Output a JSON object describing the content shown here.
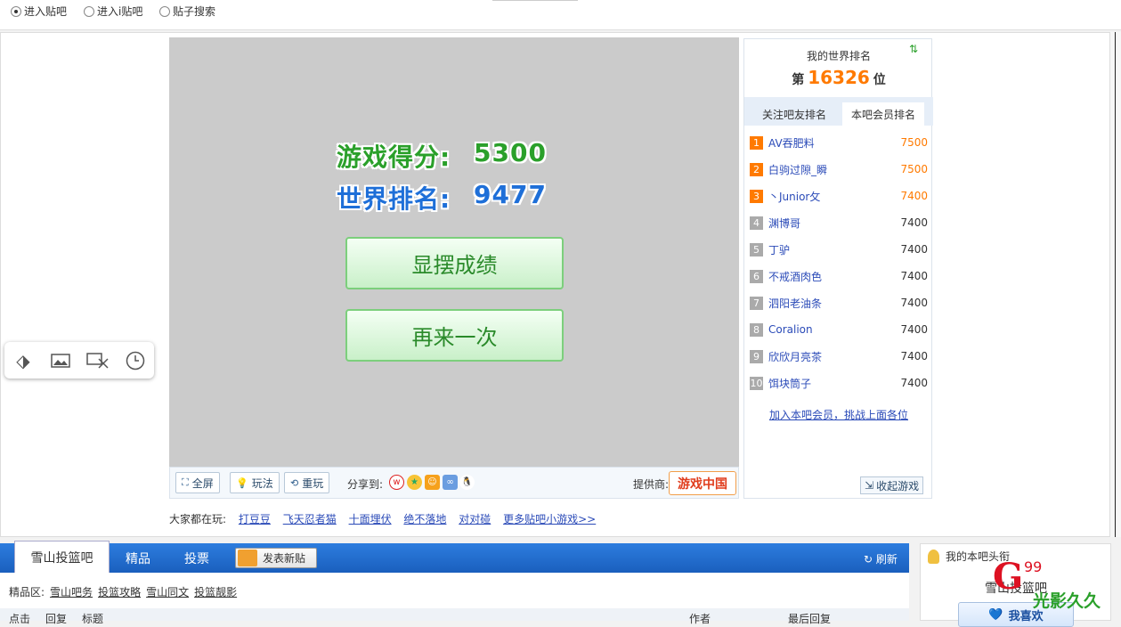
{
  "topbar": {
    "radio1": "进入贴吧",
    "radio2": "进入i贴吧",
    "radio3": "贴子搜索"
  },
  "game": {
    "score_label": "游戏得分:",
    "score_value": "5300",
    "rank_label": "世界排名:",
    "rank_value": "9477",
    "show_btn": "显摆成绩",
    "again_btn": "再来一次"
  },
  "toolbar": {
    "fullscreen": "全屏",
    "howto": "玩法",
    "replay": "重玩",
    "share_to": "分享到:",
    "provider": "提供商:",
    "provider_logo": "游戏中国"
  },
  "ranking": {
    "title": "我的世界排名",
    "prefix": "第",
    "position": "16326",
    "suffix": "位",
    "tab1": "关注吧友排名",
    "tab2": "本吧会员排名",
    "rows": [
      {
        "no": "1",
        "name": "AV吞肥料",
        "score": "7500"
      },
      {
        "no": "2",
        "name": "白驹过隙_瞬",
        "score": "7500"
      },
      {
        "no": "3",
        "name": "丶Junior攵",
        "score": "7400"
      },
      {
        "no": "4",
        "name": "渊博哥",
        "score": "7400"
      },
      {
        "no": "5",
        "name": "丁驴",
        "score": "7400"
      },
      {
        "no": "6",
        "name": "不戒酒肉色",
        "score": "7400"
      },
      {
        "no": "7",
        "name": "泗阳老油条",
        "score": "7400"
      },
      {
        "no": "8",
        "name": "Coralion",
        "score": "7400"
      },
      {
        "no": "9",
        "name": "欣欣月亮茶",
        "score": "7400"
      },
      {
        "no": "10",
        "name": "饵块筒子",
        "score": "7400"
      }
    ],
    "join": "加入本吧会员，挑战上面各位",
    "collapse": "收起游戏"
  },
  "playing": {
    "label": "大家都在玩:",
    "g1": "打豆豆",
    "g2": "飞天忍者猫",
    "g3": "十面埋伏",
    "g4": "绝不落地",
    "g5": "对对碰",
    "more": "更多贴吧小游戏>>"
  },
  "nav": {
    "bar_name": "雪山投篮吧",
    "tab2": "精品",
    "tab3": "投票",
    "newpost": "发表新贴",
    "refresh": "刷新"
  },
  "sub": {
    "label": "精品区:",
    "c1": "雪山吧务",
    "c2": "投篮攻略",
    "c3": "雪山同文",
    "c4": "投篮靓影"
  },
  "table": {
    "h1": "点击",
    "h2": "回复",
    "h3": "标题",
    "h4": "作者",
    "h5": "最后回复"
  },
  "rbox": {
    "title": "我的本吧头衔",
    "name": "雪山投篮吧",
    "like": "我喜欢"
  },
  "watermark": {
    "w1": "G",
    "w2": "99",
    "w3": "光影久久"
  },
  "colors": {
    "accent": "#1a5fbd",
    "rank_orange": "#ff7a00",
    "rank_gray": "#aaaaaa",
    "score_green": "#2aa02a",
    "score_blue": "#1e6fd8"
  }
}
